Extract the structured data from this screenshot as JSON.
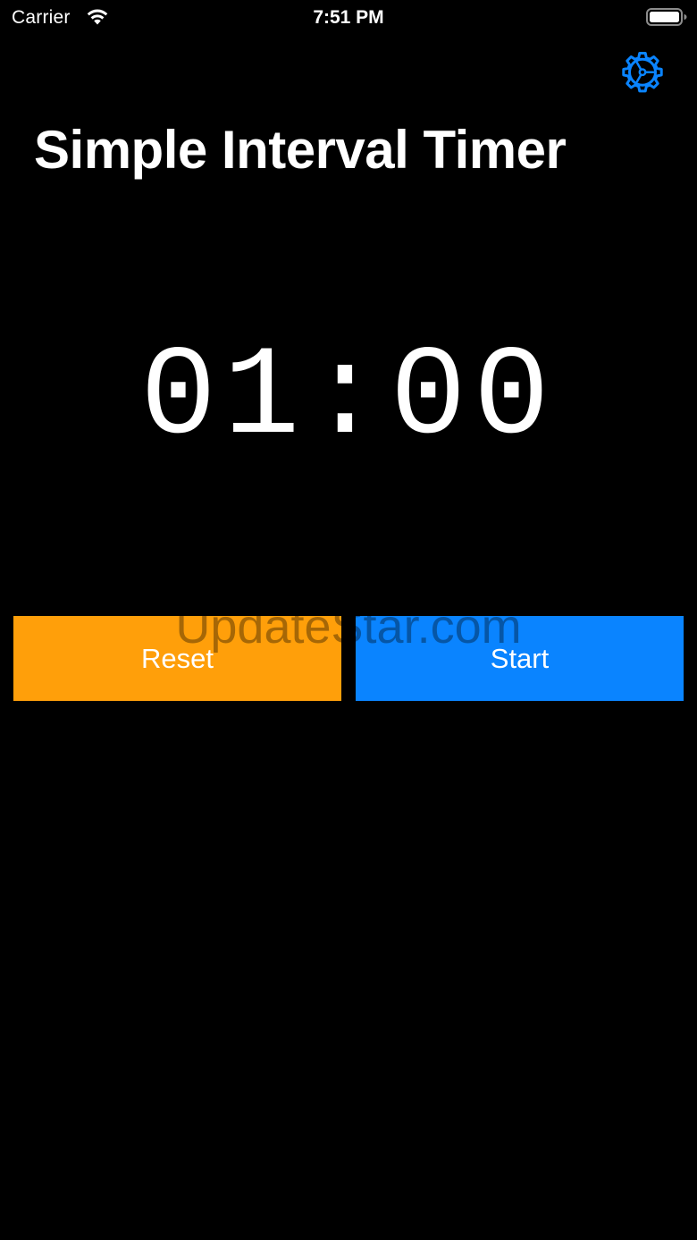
{
  "status_bar": {
    "carrier": "Carrier",
    "time": "7:51 PM",
    "wifi_icon": "wifi-icon",
    "battery_icon": "battery-icon"
  },
  "header": {
    "settings_icon": "gear-icon",
    "title": "Simple Interval Timer"
  },
  "timer": {
    "display": "01:00"
  },
  "controls": {
    "reset_label": "Reset",
    "start_label": "Start"
  },
  "watermark": "UpdateStar.com",
  "colors": {
    "background": "#000000",
    "text": "#ffffff",
    "reset_button": "#FF9F0A",
    "start_button": "#0A84FF",
    "settings_icon": "#0A84FF"
  }
}
